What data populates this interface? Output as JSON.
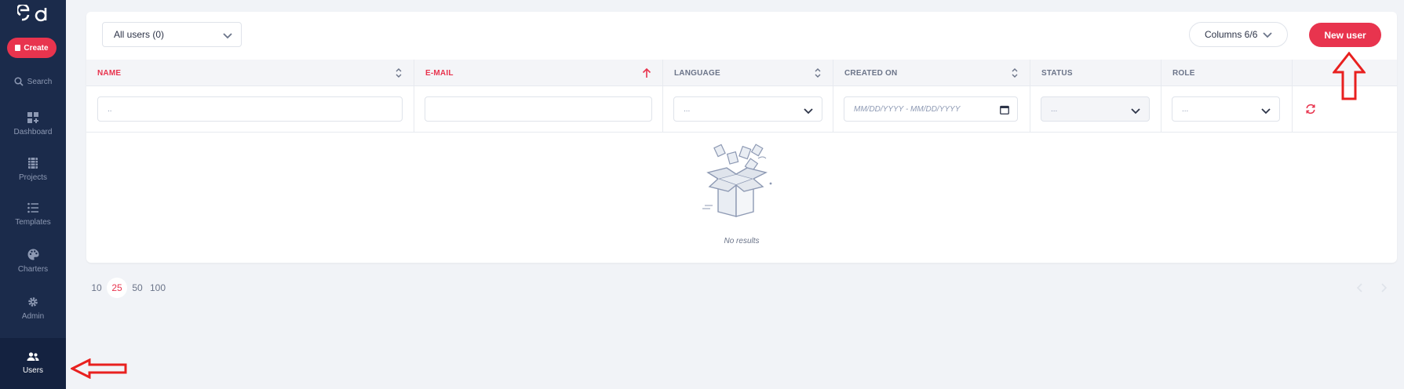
{
  "sidebar": {
    "create_label": "Create",
    "search_label": "Search",
    "items": [
      {
        "label": "Dashboard",
        "icon": "dashboard-icon"
      },
      {
        "label": "Projects",
        "icon": "projects-icon"
      },
      {
        "label": "Templates",
        "icon": "templates-icon"
      },
      {
        "label": "Charters",
        "icon": "charters-icon"
      },
      {
        "label": "Admin",
        "icon": "gear-icon"
      },
      {
        "label": "Users",
        "icon": "users-icon",
        "active": true
      }
    ]
  },
  "toolbar": {
    "users_filter": "All users (0)",
    "columns_label": "Columns 6/6",
    "new_user_label": "New user"
  },
  "table": {
    "columns": [
      {
        "label": "NAME",
        "sorted": false
      },
      {
        "label": "E-MAIL",
        "sorted": "asc"
      },
      {
        "label": "LANGUAGE",
        "sorted": false
      },
      {
        "label": "CREATED ON",
        "sorted": false
      },
      {
        "label": "STATUS",
        "sorted": false
      },
      {
        "label": "ROLE",
        "sorted": false
      }
    ],
    "filters": {
      "name_placeholder": "..",
      "email_value": "",
      "language_value": "...",
      "date_placeholder": "MM/DD/YYYY - MM/DD/YYYY",
      "status_value": "...",
      "role_value": "..."
    },
    "empty_text": "No results"
  },
  "pagination": {
    "sizes": [
      "10",
      "25",
      "50",
      "100"
    ],
    "active": "25"
  },
  "colors": {
    "accent": "#e8344e",
    "sidebar": "#1b2b4b",
    "sidebar_active": "#142240"
  }
}
